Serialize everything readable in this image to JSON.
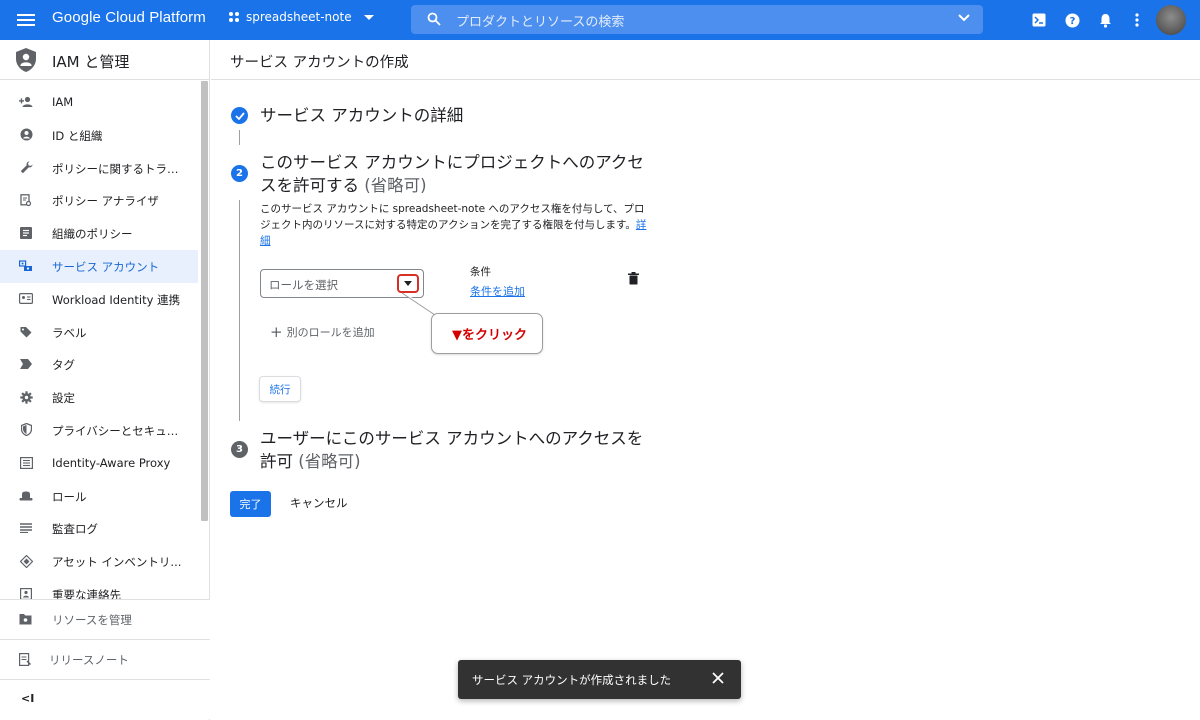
{
  "topbar": {
    "brand": "Google Cloud Platform",
    "project": "spreadsheet-note",
    "search_placeholder": "プロダクトとリソースの検索",
    "icons": [
      "menu-icon",
      "project-icon",
      "search-icon",
      "chevron-down-icon",
      "terminal-icon",
      "help-icon",
      "bell-icon",
      "more-vert-icon",
      "avatar"
    ],
    "accent": "#1a73e8"
  },
  "sidebar": {
    "title": "IAM と管理",
    "items": [
      {
        "label": "IAM",
        "icon": "person-add-icon"
      },
      {
        "label": "ID と組織",
        "icon": "account-circle-icon"
      },
      {
        "label": "ポリシーに関するトラブ...",
        "icon": "wrench-icon"
      },
      {
        "label": "ポリシー アナライザ",
        "icon": "policy-search-icon"
      },
      {
        "label": "組織のポリシー",
        "icon": "list-alt-icon"
      },
      {
        "label": "サービス アカウント",
        "icon": "service-account-icon",
        "active": true
      },
      {
        "label": "Workload Identity 連携",
        "icon": "identity-card-icon"
      },
      {
        "label": "ラベル",
        "icon": "label-icon"
      },
      {
        "label": "タグ",
        "icon": "tag-icon"
      },
      {
        "label": "設定",
        "icon": "gear-icon"
      },
      {
        "label": "プライバシーとセキュリ...",
        "icon": "shield-icon"
      },
      {
        "label": "Identity-Aware Proxy",
        "icon": "proxy-icon"
      },
      {
        "label": "ロール",
        "icon": "role-hat-icon"
      },
      {
        "label": "監査ログ",
        "icon": "list-icon"
      },
      {
        "label": "アセット インベントリ...",
        "icon": "asset-icon"
      },
      {
        "label": "重要な連絡先",
        "icon": "contact-icon"
      }
    ],
    "footer": {
      "manage_resources": "リソースを管理",
      "release_notes": "リリースノート",
      "collapse": "<I"
    }
  },
  "page": {
    "title": "サービス アカウントの作成",
    "step1": {
      "title": "サービス アカウントの詳細"
    },
    "step2": {
      "number": "2",
      "title_line1": "このサービス アカウントにプロジェクトへのアクセ",
      "title_line2": "スを許可する",
      "optional": "(省略可)",
      "desc_line1": "このサービス アカウントに spreadsheet-note へのアクセス権を付与して、プロ",
      "desc_line2": "ジェクト内のリソースに対する特定のアクションを完了する権限を付与します。",
      "desc_link1": "詳",
      "desc_link2": "細",
      "role_placeholder": "ロールを選択",
      "condition_label": "条件",
      "add_condition": "条件を追加",
      "add_role": "別のロールを追加",
      "continue": "続行"
    },
    "step3": {
      "number": "3",
      "title_line1": "ユーザーにこのサービス アカウントへのアクセスを",
      "title_line2": "許可",
      "optional": "(省略可)"
    },
    "done": "完了",
    "cancel": "キャンセル"
  },
  "annotation": {
    "callout": "▼をクリック",
    "color": "#d40000"
  },
  "snackbar": {
    "message": "サービス アカウントが作成されました"
  }
}
